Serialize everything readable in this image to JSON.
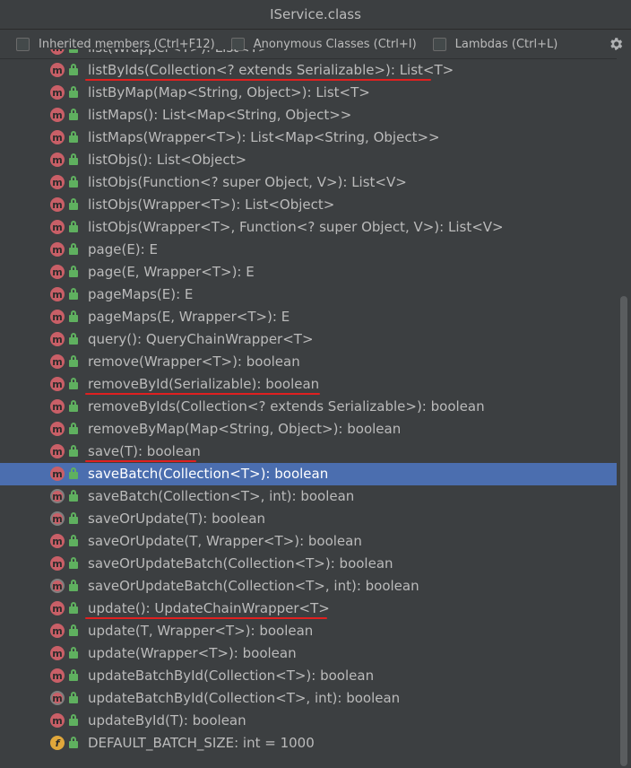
{
  "window": {
    "title": "IService.class"
  },
  "toolbar": {
    "inherited_label": "Inherited members (Ctrl+F12)",
    "anonymous_label": "Anonymous Classes (Ctrl+I)",
    "lambdas_label": "Lambdas (Ctrl+L)"
  },
  "icons": {
    "method_letter": "m",
    "field_letter": "f"
  },
  "colors": {
    "background": "#3c3f41",
    "selection": "#4b6eaf",
    "method_icon": "#c95f67",
    "field_icon": "#e0a73b",
    "lock": "#5fb05f",
    "annotation_underline": "#e02020"
  },
  "members": [
    {
      "label": "list(Wrapper<T>): List<T>",
      "kind": "method"
    },
    {
      "label": "listByIds(Collection<? extends Serializable>): List<T>",
      "kind": "method",
      "underlined": true
    },
    {
      "label": "listByMap(Map<String, Object>): List<T>",
      "kind": "method"
    },
    {
      "label": "listMaps(): List<Map<String, Object>>",
      "kind": "method"
    },
    {
      "label": "listMaps(Wrapper<T>): List<Map<String, Object>>",
      "kind": "method"
    },
    {
      "label": "listObjs(): List<Object>",
      "kind": "method"
    },
    {
      "label": "listObjs(Function<? super Object, V>): List<V>",
      "kind": "method"
    },
    {
      "label": "listObjs(Wrapper<T>): List<Object>",
      "kind": "method"
    },
    {
      "label": "listObjs(Wrapper<T>, Function<? super Object, V>): List<V>",
      "kind": "method"
    },
    {
      "label": "page(E): E",
      "kind": "method"
    },
    {
      "label": "page(E, Wrapper<T>): E",
      "kind": "method"
    },
    {
      "label": "pageMaps(E): E",
      "kind": "method"
    },
    {
      "label": "pageMaps(E, Wrapper<T>): E",
      "kind": "method"
    },
    {
      "label": "query(): QueryChainWrapper<T>",
      "kind": "method"
    },
    {
      "label": "remove(Wrapper<T>): boolean",
      "kind": "method"
    },
    {
      "label": "removeById(Serializable): boolean",
      "kind": "method",
      "underlined": true
    },
    {
      "label": "removeByIds(Collection<? extends Serializable>): boolean",
      "kind": "method"
    },
    {
      "label": "removeByMap(Map<String, Object>): boolean",
      "kind": "method"
    },
    {
      "label": "save(T): boolean",
      "kind": "method",
      "underlined": true
    },
    {
      "label": "saveBatch(Collection<T>): boolean",
      "kind": "method",
      "selected": true
    },
    {
      "label": "saveBatch(Collection<T>, int): boolean",
      "kind": "method-default"
    },
    {
      "label": "saveOrUpdate(T): boolean",
      "kind": "method-default"
    },
    {
      "label": "saveOrUpdate(T, Wrapper<T>): boolean",
      "kind": "method"
    },
    {
      "label": "saveOrUpdateBatch(Collection<T>): boolean",
      "kind": "method"
    },
    {
      "label": "saveOrUpdateBatch(Collection<T>, int): boolean",
      "kind": "method-default"
    },
    {
      "label": "update(): UpdateChainWrapper<T>",
      "kind": "method",
      "underlined": true
    },
    {
      "label": "update(T, Wrapper<T>): boolean",
      "kind": "method"
    },
    {
      "label": "update(Wrapper<T>): boolean",
      "kind": "method"
    },
    {
      "label": "updateBatchById(Collection<T>): boolean",
      "kind": "method"
    },
    {
      "label": "updateBatchById(Collection<T>, int): boolean",
      "kind": "method-default"
    },
    {
      "label": "updateById(T): boolean",
      "kind": "method"
    },
    {
      "label": "DEFAULT_BATCH_SIZE: int = 1000",
      "kind": "field"
    }
  ]
}
